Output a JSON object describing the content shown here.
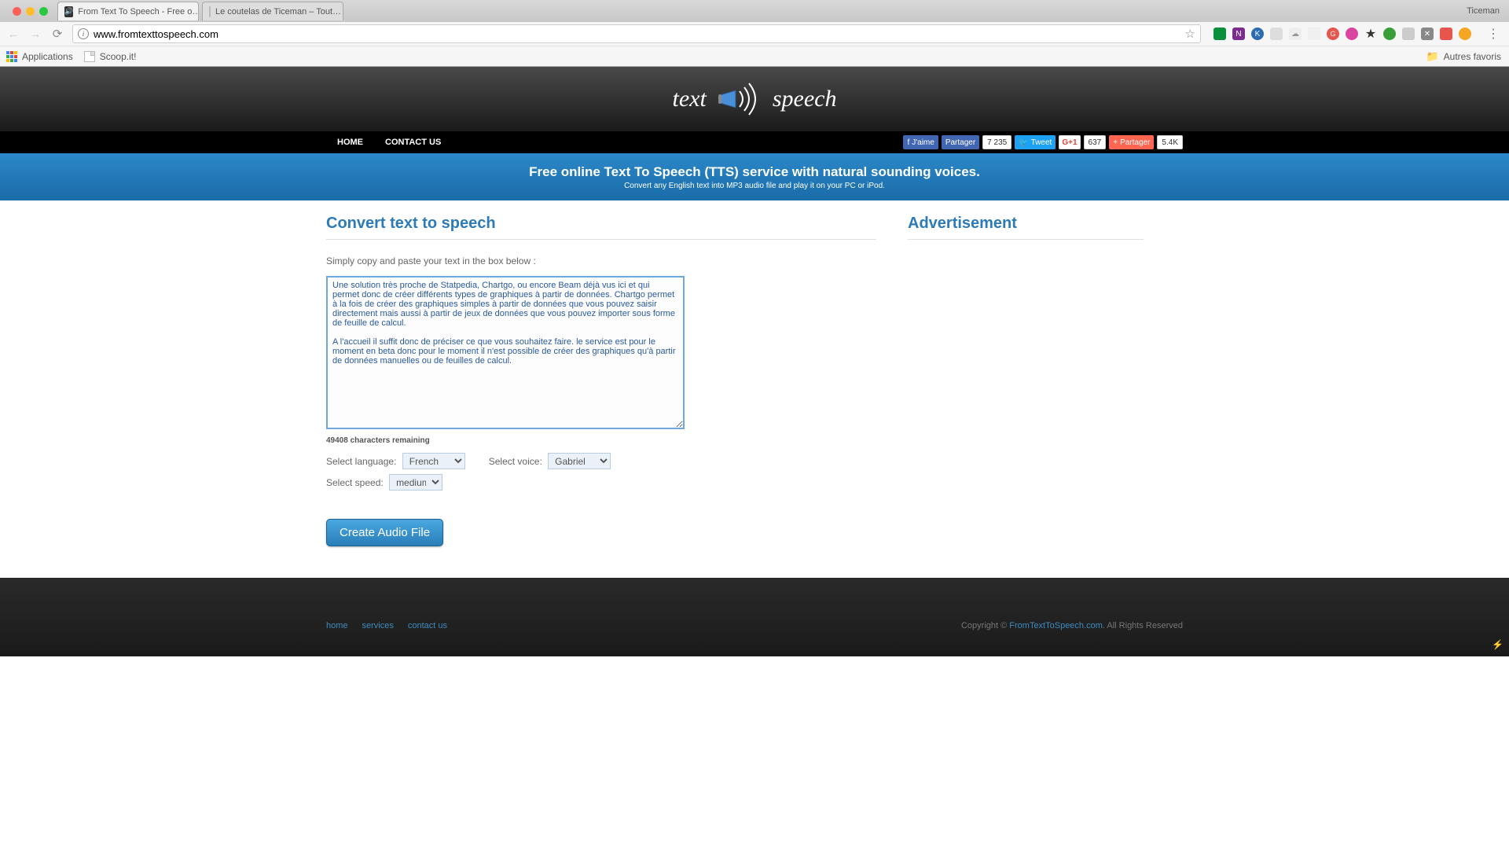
{
  "browser": {
    "profile_name": "Ticeman",
    "tabs": [
      {
        "title": "From Text To Speech - Free o…",
        "active": true
      },
      {
        "title": "Le coutelas de Ticeman – Tout…",
        "active": false
      }
    ],
    "url": "www.fromtexttospeech.com",
    "bookmarks": {
      "apps_label": "Applications",
      "item1": "Scoop.it!",
      "other_label": "Autres favoris"
    }
  },
  "nav": {
    "home": "HOME",
    "contact": "CONTACT US"
  },
  "social": {
    "fb_like": "J'aime",
    "fb_share": "Partager",
    "fb_count": "7 235",
    "tw_tweet": "Tweet",
    "gp_label": "G+1",
    "gp_count": "637",
    "at_share": "Partager",
    "at_count": "5.4K"
  },
  "hero": {
    "title": "Free online Text To Speech (TTS) service with natural sounding voices.",
    "subtitle": "Convert any English text into MP3 audio file and play it on your PC or iPod."
  },
  "main": {
    "section_title": "Convert text to speech",
    "instruction": "Simply copy and paste your text in the box below :",
    "textarea_value": "Une solution très proche de Statpedia, Chartgo, ou encore Beam déjà vus ici et qui permet donc de créer différents types de graphiques à partir de données. Chartgo permet à la fois de créer des graphiques simples à partir de données que vous pouvez saisir directement mais aussi à partir de jeux de données que vous pouvez importer sous forme de feuille de calcul.\n\nA l'accueil il suffit donc de préciser ce que vous souhaitez faire. le service est pour le moment en beta donc pour le moment il n'est possible de créer des graphiques qu'à partir de données manuelles ou de feuilles de calcul.",
    "char_remaining": "49408 characters remaining",
    "lang_label": "Select language:",
    "lang_value": "French",
    "voice_label": "Select voice:",
    "voice_value": "Gabriel",
    "speed_label": "Select speed:",
    "speed_value": "medium",
    "create_btn": "Create Audio File"
  },
  "sidebar": {
    "ad_title": "Advertisement"
  },
  "footer": {
    "home": "home",
    "services": "services",
    "contact": "contact us",
    "copyright_pre": "Copyright © ",
    "copyright_link": "FromTextToSpeech.com",
    "copyright_post": ". All Rights Reserved"
  },
  "logo": {
    "left": "text",
    "right": "speech"
  }
}
